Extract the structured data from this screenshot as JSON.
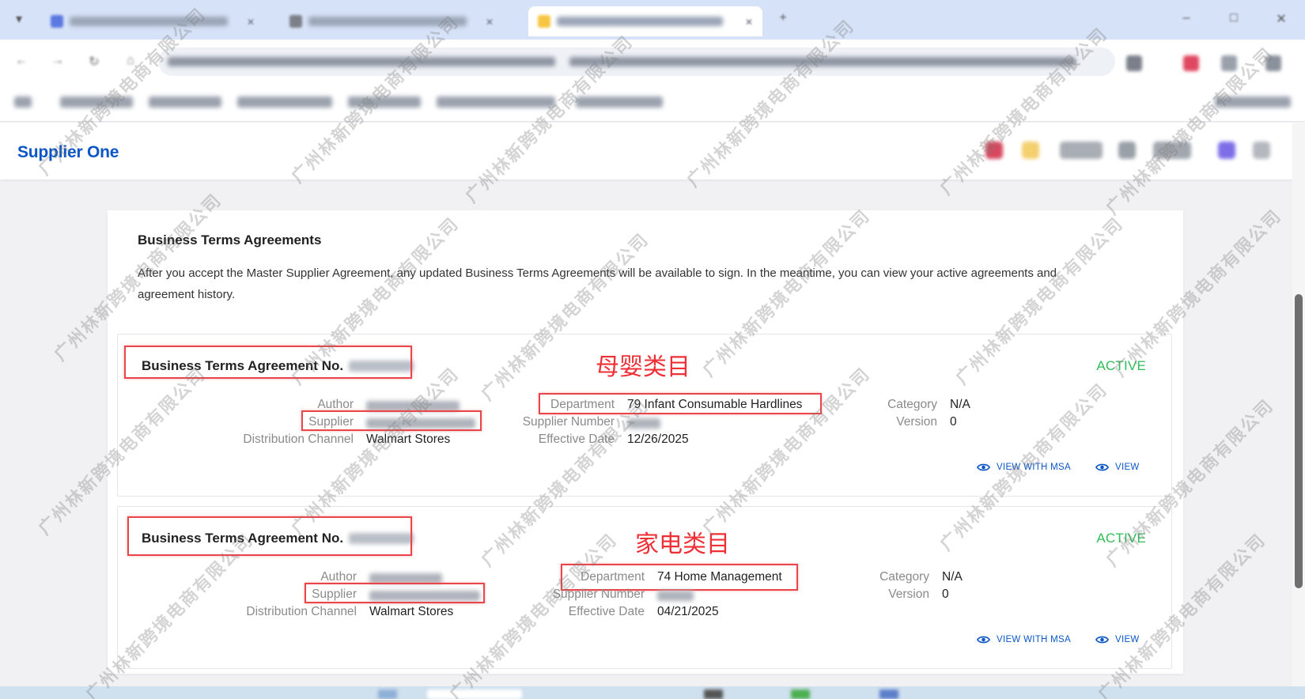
{
  "app": {
    "brand": "Supplier One"
  },
  "page": {
    "section_title": "Business Terms Agreements",
    "section_desc": "After you accept the Master Supplier Agreement, any updated Business Terms Agreements will be available to sign. In the meantime, you can view your active agreements and agreement history."
  },
  "labels": {
    "author": "Author",
    "supplier": "Supplier",
    "distribution_channel": "Distribution Channel",
    "department": "Department",
    "supplier_number": "Supplier Number",
    "effective_date": "Effective Date",
    "category": "Category",
    "version": "Version",
    "view_with_msa": "VIEW WITH MSA",
    "view": "VIEW"
  },
  "agreements": [
    {
      "title": "Business Terms Agreement No.",
      "status": "ACTIVE",
      "annotation": "母婴类目",
      "distribution_channel": "Walmart Stores",
      "department": "79 Infant Consumable Hardlines",
      "effective_date": "12/26/2025",
      "category": "N/A",
      "version": "0"
    },
    {
      "title": "Business Terms Agreement No.",
      "status": "ACTIVE",
      "annotation": "家电类目",
      "distribution_channel": "Walmart Stores",
      "department": "74 Home Management",
      "effective_date": "04/21/2025",
      "category": "N/A",
      "version": "0"
    }
  ],
  "watermark": {
    "text": "广州林新跨境电商有限公司"
  },
  "colors": {
    "brand": "#0a56c7",
    "active": "#2dbd58",
    "annotation": "#ef2f36",
    "highlight_box": "#e8464b"
  },
  "icons": {
    "view": "eye-icon"
  }
}
